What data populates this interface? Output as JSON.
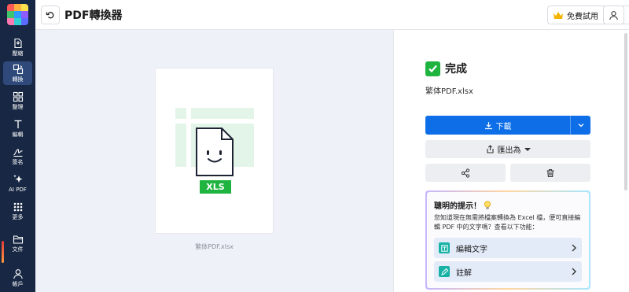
{
  "app": {
    "title": "PDF轉換器"
  },
  "sidebar": {
    "items": [
      {
        "label": "壓縮",
        "icon": "compress-icon"
      },
      {
        "label": "轉換",
        "icon": "convert-icon"
      },
      {
        "label": "整理",
        "icon": "organize-icon"
      },
      {
        "label": "編輯",
        "icon": "edit-text-icon"
      },
      {
        "label": "簽名",
        "icon": "signature-icon"
      },
      {
        "label": "AI PDF",
        "icon": "ai-sparkle-icon"
      },
      {
        "label": "更多",
        "icon": "more-grid-icon"
      },
      {
        "label": "文件",
        "icon": "folder-icon"
      },
      {
        "label": "帳戶",
        "icon": "account-icon"
      }
    ],
    "active": "轉換"
  },
  "topbar": {
    "trial_label": "免費試用"
  },
  "preview": {
    "file_type": "XLS",
    "caption": "繁体PDF.xlsx"
  },
  "result": {
    "status": "完成",
    "file_name": "繁体PDF.xlsx",
    "download_label": "下載",
    "export_label": "匯出為"
  },
  "tip": {
    "title": "聰明的提示！",
    "body": "您知道現在無需將檔案轉換為 Excel 檔，便可直接編輯 PDF 中的文字嗎？查看以下功能：",
    "options": [
      {
        "label": "編輯文字",
        "icon": "edit-text-icon"
      },
      {
        "label": "註解",
        "icon": "annotate-pen-icon"
      }
    ]
  },
  "colors": {
    "sidebar_bg": "#182844",
    "primary": "#0d6ee8",
    "success": "#1fb340",
    "xls_badge": "#1fb340",
    "preview_bg": "#eef1f8"
  }
}
